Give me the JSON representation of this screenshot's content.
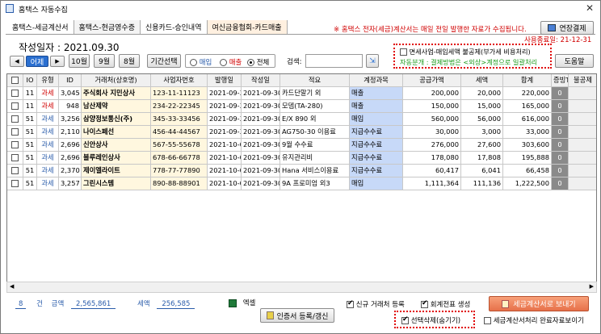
{
  "title": "홈택스 자동수집",
  "tabs": [
    "홈택스-세금계산서",
    "홈택스-현금영수증",
    "신용카드-승인내역",
    "여신금융협회-카드매출"
  ],
  "notice": "※ 홈택스 전자(세금)계산서는 매일 전일 발행한 자료가 수집됩니다.",
  "extend_button": "연장결제",
  "date_label": "작성일자 : 2021.09.30",
  "expire": "사용종료일: 21-12-31",
  "nav": {
    "prev": "◀",
    "yesterday": "어제",
    "next": "▶",
    "m10": "10월",
    "m9": "9월",
    "m8": "8월",
    "period": "기간선택"
  },
  "radio": {
    "purchase": "매입",
    "sales": "매출",
    "all": "전체"
  },
  "search": {
    "label": "검색:",
    "value": ""
  },
  "options": {
    "exempt": "면세사업-매입세액 불공제(부가세 비용처리)",
    "auto": "자동분개 : 결제방법은 <외상>계정으로 일괄처리"
  },
  "help_button": "도움말",
  "columns": [
    "IO",
    "유형",
    "ID",
    "거래처(상호명)",
    "사업자번호",
    "발행일",
    "작성일",
    "적요",
    "계정과목",
    "공급가액",
    "세액",
    "합계",
    "증빙T",
    "불공제"
  ],
  "rows": [
    [
      "11",
      "과세",
      "3,045",
      "주식회사 지민상사",
      "123-11-11123",
      "2021-09-30",
      "2021-09-30",
      "카드단말기 외",
      "매출",
      "200,000",
      "20,000",
      "220,000",
      "0",
      ""
    ],
    [
      "11",
      "과세",
      "948",
      "남산제약",
      "234-22-22345",
      "2021-09-30",
      "2021-09-30",
      "모뎀(TA-280)",
      "매출",
      "150,000",
      "15,000",
      "165,000",
      "0",
      ""
    ],
    [
      "51",
      "과세",
      "3,256",
      "삼양정보통신(주)",
      "345-33-33456",
      "2021-09-30",
      "2021-09-30",
      "E/X 890 외",
      "매입",
      "560,000",
      "56,000",
      "616,000",
      "0",
      ""
    ],
    [
      "51",
      "과세",
      "2,110",
      "나이스페선",
      "456-44-44567",
      "2021-09-30",
      "2021-09-30",
      "AG750-30 이용료",
      "지급수수료",
      "30,000",
      "3,000",
      "33,000",
      "0",
      ""
    ],
    [
      "51",
      "과세",
      "2,696",
      "신안상사",
      "567-55-55678",
      "2021-10-05",
      "2021-09-30",
      "9월 수수료",
      "지급수수료",
      "276,000",
      "27,600",
      "303,600",
      "0",
      ""
    ],
    [
      "51",
      "과세",
      "2,696",
      "블루레인상사",
      "678-66-66778",
      "2021-10-05",
      "2021-09-30",
      "유지관리비",
      "지급수수료",
      "178,080",
      "17,808",
      "195,888",
      "0",
      ""
    ],
    [
      "51",
      "과세",
      "2,370",
      "제이엘라이트",
      "778-77-77890",
      "2021-10-05",
      "2021-09-30",
      "Hana 서비스이용료",
      "지급수수료",
      "60,417",
      "6,041",
      "66,458",
      "0",
      ""
    ],
    [
      "51",
      "과세",
      "3,257",
      "그린시스템",
      "890-88-88901",
      "2021-10-06",
      "2021-09-30",
      "9A 프로미엄 외3",
      "매입",
      "1,111,364",
      "111,136",
      "1,222,500",
      "0",
      ""
    ]
  ],
  "footer": {
    "count": "8",
    "count_unit": "건",
    "amount_label": "금액",
    "amount": "2,565,861",
    "tax_label": "세액",
    "tax": "256,585",
    "excel": "엑셀",
    "cert": "인증서 등록/갱신",
    "new_client": "신규 거래처 등록",
    "voucher": "회계전표 생성",
    "send_tax": "세금계산서로 보내기",
    "delete_sel": "선택삭제(숨기기)",
    "show_done": "세금계산서처리 완료자료보이기"
  }
}
